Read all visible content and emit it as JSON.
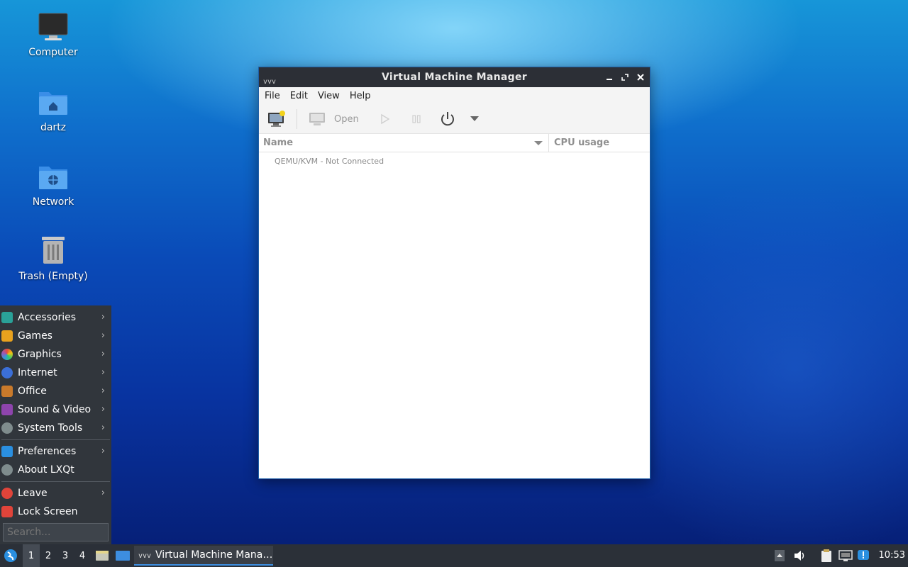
{
  "desktop": {
    "icons": [
      {
        "label": "Computer",
        "icon": "computer-icon"
      },
      {
        "label": "dartz",
        "icon": "home-folder-icon"
      },
      {
        "label": "Network",
        "icon": "network-folder-icon"
      },
      {
        "label": "Trash (Empty)",
        "icon": "trash-icon"
      }
    ]
  },
  "window": {
    "title": "Virtual Machine Manager",
    "menus": [
      "File",
      "Edit",
      "View",
      "Help"
    ],
    "toolbar": {
      "new_vm": "new-vm-icon",
      "open_label": "Open",
      "run": "play-icon",
      "pause": "pause-icon",
      "shutdown": "power-icon",
      "more": "dropdown-arrow-icon"
    },
    "columns": {
      "name": "Name",
      "cpu": "CPU usage"
    },
    "connection": "QEMU/KVM - Not Connected"
  },
  "start_menu": {
    "categories": [
      {
        "label": "Accessories",
        "submenu": true,
        "color": "#2aa198"
      },
      {
        "label": "Games",
        "submenu": true,
        "color": "#e8a21e"
      },
      {
        "label": "Graphics",
        "submenu": true,
        "color": "#d9534f"
      },
      {
        "label": "Internet",
        "submenu": true,
        "color": "#3b6fd8"
      },
      {
        "label": "Office",
        "submenu": true,
        "color": "#c97a2b"
      },
      {
        "label": "Sound & Video",
        "submenu": true,
        "color": "#8e44ad"
      },
      {
        "label": "System Tools",
        "submenu": true,
        "color": "#7f8c8d"
      }
    ],
    "settings": [
      {
        "label": "Preferences",
        "submenu": true,
        "color": "#2a8fe0"
      },
      {
        "label": "About LXQt",
        "submenu": false,
        "color": "#7f8c8d"
      }
    ],
    "session": [
      {
        "label": "Leave",
        "submenu": true,
        "color": "#e0443a"
      },
      {
        "label": "Lock Screen",
        "submenu": false,
        "color": "#e0443a"
      }
    ],
    "search_placeholder": "Search..."
  },
  "panel": {
    "desktops": [
      "1",
      "2",
      "3",
      "4"
    ],
    "active_desktop": "1",
    "task_label": "Virtual Machine Mana…",
    "clock": "10:53"
  }
}
